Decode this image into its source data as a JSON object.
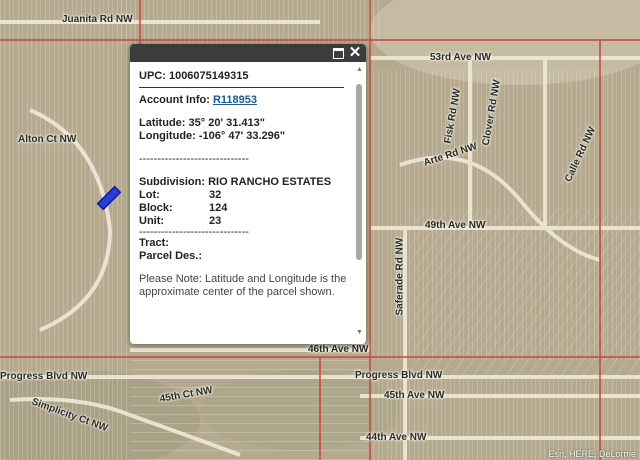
{
  "map": {
    "streets": [
      {
        "id": "street-juanita-rd",
        "text": "Juanita Rd NW"
      },
      {
        "id": "street-53rd-ave",
        "text": "53rd Ave NW"
      },
      {
        "id": "street-alton-ct",
        "text": "Alton Ct NW"
      },
      {
        "id": "street-arte-rd",
        "text": "Arte Rd NW"
      },
      {
        "id": "street-49th-ave",
        "text": "49th Ave NW"
      },
      {
        "id": "street-46th-ave",
        "text": "46th Ave NW"
      },
      {
        "id": "street-progress-blvd-left",
        "text": "Progress Blvd NW"
      },
      {
        "id": "street-progress-blvd-right",
        "text": "Progress Blvd NW"
      },
      {
        "id": "street-45th-ave",
        "text": "45th Ave NW"
      },
      {
        "id": "street-simplicity-ct",
        "text": "Simplicity Ct NW"
      },
      {
        "id": "street-45th-ct",
        "text": "45th Ct NW"
      },
      {
        "id": "street-44th-ave",
        "text": "44th Ave NW"
      },
      {
        "id": "street-saferade-rd",
        "text": "Saferade Rd NW"
      },
      {
        "id": "street-fisk-rd",
        "text": "Fisk Rd NW"
      },
      {
        "id": "street-clover-rd",
        "text": "Clover Rd NW"
      },
      {
        "id": "street-calle-rd",
        "text": "Calle Rd NW"
      }
    ],
    "attribution": "Esri, HERE, DeLorme"
  },
  "popup": {
    "upc_label": "UPC:",
    "upc_value": "1006075149315",
    "account_label": "Account Info:",
    "account_link": "R118953",
    "latitude_label": "Latitude:",
    "latitude_value": "35° 20' 31.413\"",
    "longitude_label": "Longitude:",
    "longitude_value": "-106° 47' 33.296\"",
    "dash_line": "------------------------------",
    "subdivision_label": "Subdivision:",
    "subdivision_value": "RIO RANCHO ESTATES",
    "lot_label": "Lot:",
    "lot_value": "32",
    "block_label": "Block:",
    "block_value": "124",
    "unit_label": "Unit:",
    "unit_value": "23",
    "tract_label": "Tract:",
    "parcel_label": "Parcel Des.:",
    "note": "Please Note: Latitude and Longitude is the approximate center of the parcel shown."
  }
}
